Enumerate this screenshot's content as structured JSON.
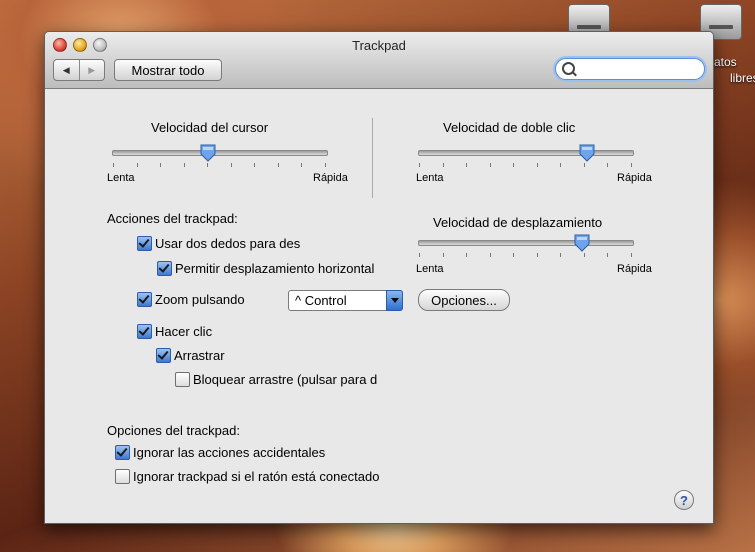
{
  "desktop": {
    "drive_label_1": "atos",
    "drive_label_2": "libres"
  },
  "window": {
    "title": "Trackpad",
    "show_all_label": "Mostrar todo",
    "search": {
      "value": "",
      "placeholder": ""
    }
  },
  "sliders": {
    "cursor_speed": {
      "title": "Velocidad del cursor",
      "min_label": "Lenta",
      "max_label": "Rápida",
      "value_fraction": 0.45
    },
    "double_click_speed": {
      "title": "Velocidad de doble clic",
      "min_label": "Lenta",
      "max_label": "Rápida",
      "value_fraction": 0.78
    },
    "scroll_speed": {
      "title": "Velocidad de desplazamiento",
      "min_label": "Lenta",
      "max_label": "Rápida",
      "value_fraction": 0.75
    }
  },
  "trackpad_actions": {
    "heading": "Acciones del trackpad:",
    "two_finger_scroll": {
      "label": "Usar dos dedos para des",
      "checked": true
    },
    "horizontal_scroll": {
      "label": "Permitir desplazamiento horizontal",
      "checked": true
    },
    "zoom": {
      "label": "Zoom pulsando",
      "checked": true
    },
    "zoom_modifier": "^ Control",
    "options_button": "Opciones...",
    "tap_to_click": {
      "label": "Hacer clic",
      "checked": true
    },
    "drag": {
      "label": "Arrastrar",
      "checked": true
    },
    "drag_lock": {
      "label": "Bloquear arrastre (pulsar para d",
      "checked": false
    }
  },
  "trackpad_options": {
    "heading": "Opciones del trackpad:",
    "ignore_accidental": {
      "label": "Ignorar las acciones accidentales",
      "checked": true
    },
    "ignore_with_mouse": {
      "label": "Ignorar trackpad si el ratón está conectado",
      "checked": false
    }
  },
  "help_label": "?"
}
